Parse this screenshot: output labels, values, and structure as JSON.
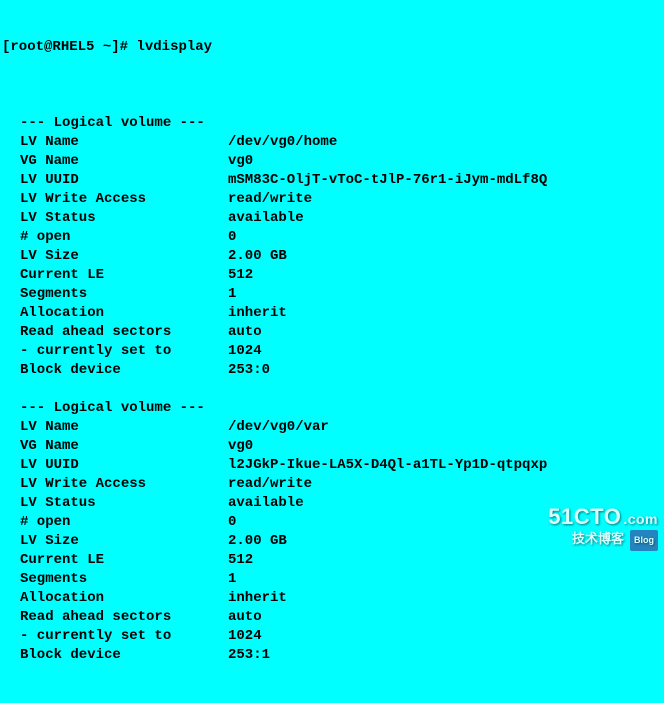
{
  "prompt": {
    "user": "root",
    "host": "RHEL5",
    "dir": "~",
    "symbol": "#",
    "command": "lvdisplay"
  },
  "volume_header": "--- Logical volume ---",
  "volumes": [
    {
      "rows": [
        {
          "label": "LV Name",
          "value": "/dev/vg0/home"
        },
        {
          "label": "VG Name",
          "value": "vg0"
        },
        {
          "label": "LV UUID",
          "value": "mSM83C-OljT-vToC-tJlP-76r1-iJym-mdLf8Q"
        },
        {
          "label": "LV Write Access",
          "value": "read/write"
        },
        {
          "label": "LV Status",
          "value": "available"
        },
        {
          "label": "# open",
          "value": "0"
        },
        {
          "label": "LV Size",
          "value": "2.00 GB"
        },
        {
          "label": "Current LE",
          "value": "512"
        },
        {
          "label": "Segments",
          "value": "1"
        },
        {
          "label": "Allocation",
          "value": "inherit"
        },
        {
          "label": "Read ahead sectors",
          "value": "auto"
        },
        {
          "label": "- currently set to",
          "value": "1024"
        },
        {
          "label": "Block device",
          "value": "253:0"
        }
      ]
    },
    {
      "rows": [
        {
          "label": "LV Name",
          "value": "/dev/vg0/var"
        },
        {
          "label": "VG Name",
          "value": "vg0"
        },
        {
          "label": "LV UUID",
          "value": "l2JGkP-Ikue-LA5X-D4Ql-a1TL-Yp1D-qtpqxp"
        },
        {
          "label": "LV Write Access",
          "value": "read/write"
        },
        {
          "label": "LV Status",
          "value": "available"
        },
        {
          "label": "# open",
          "value": "0"
        },
        {
          "label": "LV Size",
          "value": "2.00 GB"
        },
        {
          "label": "Current LE",
          "value": "512"
        },
        {
          "label": "Segments",
          "value": "1"
        },
        {
          "label": "Allocation",
          "value": "inherit"
        },
        {
          "label": "Read ahead sectors",
          "value": "auto"
        },
        {
          "label": "- currently set to",
          "value": "1024"
        },
        {
          "label": "Block device",
          "value": "253:1"
        }
      ]
    }
  ],
  "watermark": {
    "brand": "51CTO",
    "dotcom": ".com",
    "tagline": "技术博客",
    "badge": "Blog"
  }
}
